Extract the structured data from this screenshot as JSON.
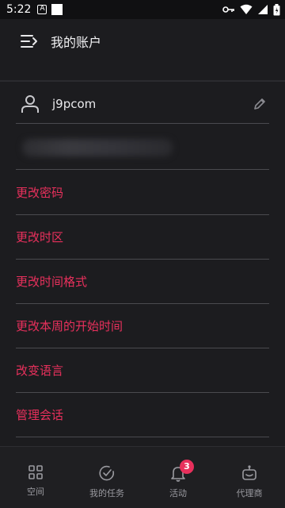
{
  "status_bar": {
    "time": "5:22",
    "a_glyph": "A"
  },
  "app_bar": {
    "title": "我的账户",
    "menu_icon": "menu-collapse-icon"
  },
  "profile": {
    "username": "j9pcom",
    "user_icon": "user-icon",
    "edit_icon": "pencil-icon"
  },
  "menu": [
    {
      "label": "更改密码"
    },
    {
      "label": "更改时区"
    },
    {
      "label": "更改时间格式"
    },
    {
      "label": "更改本周的开始时间"
    },
    {
      "label": "改变语言"
    },
    {
      "label": "管理会话"
    }
  ],
  "bottom_nav": {
    "items": [
      {
        "label": "空间",
        "icon": "grid-icon"
      },
      {
        "label": "我的任务",
        "icon": "check-circle-icon"
      },
      {
        "label": "活动",
        "icon": "bell-icon",
        "badge": "3"
      },
      {
        "label": "代理商",
        "icon": "robot-icon"
      }
    ]
  },
  "colors": {
    "accent": "#e8305c",
    "background": "#1c1c1f",
    "divider": "#4a4a4f"
  }
}
